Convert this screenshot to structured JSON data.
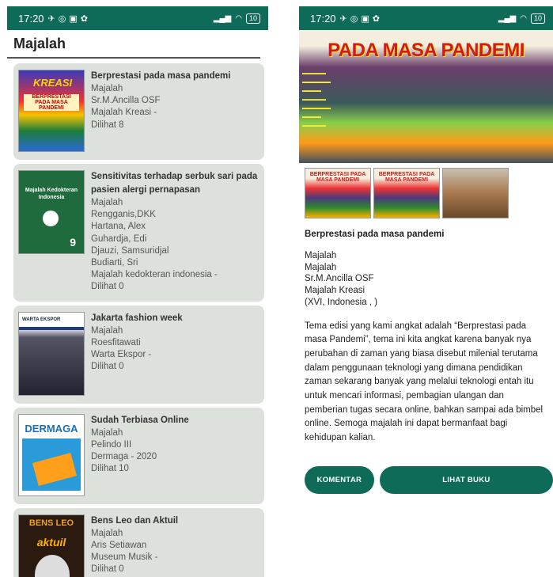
{
  "status_bar": {
    "time": "17:20",
    "battery": "10"
  },
  "list_screen": {
    "title": "Majalah",
    "items": [
      {
        "title": "Berprestasi pada masa pandemi",
        "lines": [
          "Majalah",
          "Sr.M.Ancilla OSF",
          "Majalah Kreasi -",
          "Dilihat 8"
        ],
        "cover_text": [
          "KREASI",
          "BERPRESTASI PADA MASA PANDEMI"
        ]
      },
      {
        "title": "Sensitivitas terhadap serbuk sari pada pasien alergi pernapasan",
        "lines": [
          "Majalah",
          "Rengganis,DKK",
          "Hartana, Alex",
          "Guhardja, Edi",
          "Djauzi, Samsuridjal",
          "Budiarti, Sri",
          "Majalah kedokteran indonesia  -",
          "Dilihat 0"
        ],
        "cover_text": [
          "Majalah Kedokteran Indonesia",
          "9"
        ]
      },
      {
        "title": "Jakarta fashion week",
        "lines": [
          "Majalah",
          "Roesfitawati",
          "Warta Ekspor  -",
          "Dilihat 0"
        ],
        "cover_text": [
          "WARTA EKSPOR"
        ]
      },
      {
        "title": "Sudah Terbiasa Online",
        "lines": [
          "Majalah",
          "Pelindo III",
          "Dermaga  - 2020",
          "Dilihat 10"
        ],
        "cover_text": [
          "DERMAGA"
        ]
      },
      {
        "title": "Bens Leo dan Aktuil",
        "lines": [
          "Majalah",
          "Aris Setiawan",
          "Museum Musik -",
          "Dilihat 0"
        ],
        "cover_text": [
          "BENS LEO",
          "aktuil"
        ]
      }
    ]
  },
  "detail_screen": {
    "hero_title": "PADA MASA PANDEMI",
    "title": "Berprestasi pada masa pandemi",
    "meta": [
      "Majalah",
      "Majalah",
      "Sr.M.Ancilla OSF",
      "Majalah Kreasi",
      "(XVI, Indonesia , )"
    ],
    "description": "Tema edisi yang kami angkat adalah “Berprestasi pada masa Pandemi”, tema ini kita angkat karena banyak nya perubahan di zaman yang biasa disebut milenial terutama dalam penggunaan teknologi yang dimana pendidikan zaman sekarang banyak yang melalui teknologi entah itu untuk mencari informasi, pembagian ulangan dan pemberian tugas secara online, bahkan sampai ada bimbel online. Semoga majalah ini dapat bermanfaat bagi kehidupan kalian.",
    "thumb_label": "BERPRESTASI PADA MASA PANDEMI",
    "buttons": {
      "komentar": "KOMENTAR",
      "lihat_buku": "LIHAT BUKU"
    }
  },
  "colors": {
    "primary": "#0e6b58",
    "card_bg": "#dde1dc"
  }
}
